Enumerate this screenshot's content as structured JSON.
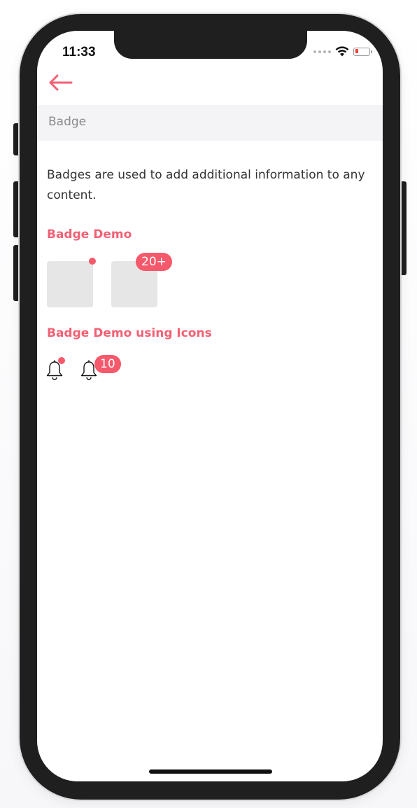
{
  "status_bar": {
    "time": "11:33",
    "wifi_icon": "wifi-icon",
    "battery_icon": "battery-icon",
    "battery_color": "#ff3b30"
  },
  "nav": {
    "back_icon": "arrow-left-icon",
    "accent_color": "#f26174"
  },
  "header": {
    "title": "Badge"
  },
  "main": {
    "description": "Badges are used to add additional information to any content.",
    "badge_demo": {
      "title": "Badge Demo",
      "count_label": "20+"
    },
    "icon_demo": {
      "title": "Badge Demo using Icons",
      "icon": "bell-icon",
      "count_label": "10"
    }
  },
  "colors": {
    "badge": "#f5596b",
    "placeholder_box": "#e6e6e6",
    "header_bg": "#f4f4f7"
  }
}
